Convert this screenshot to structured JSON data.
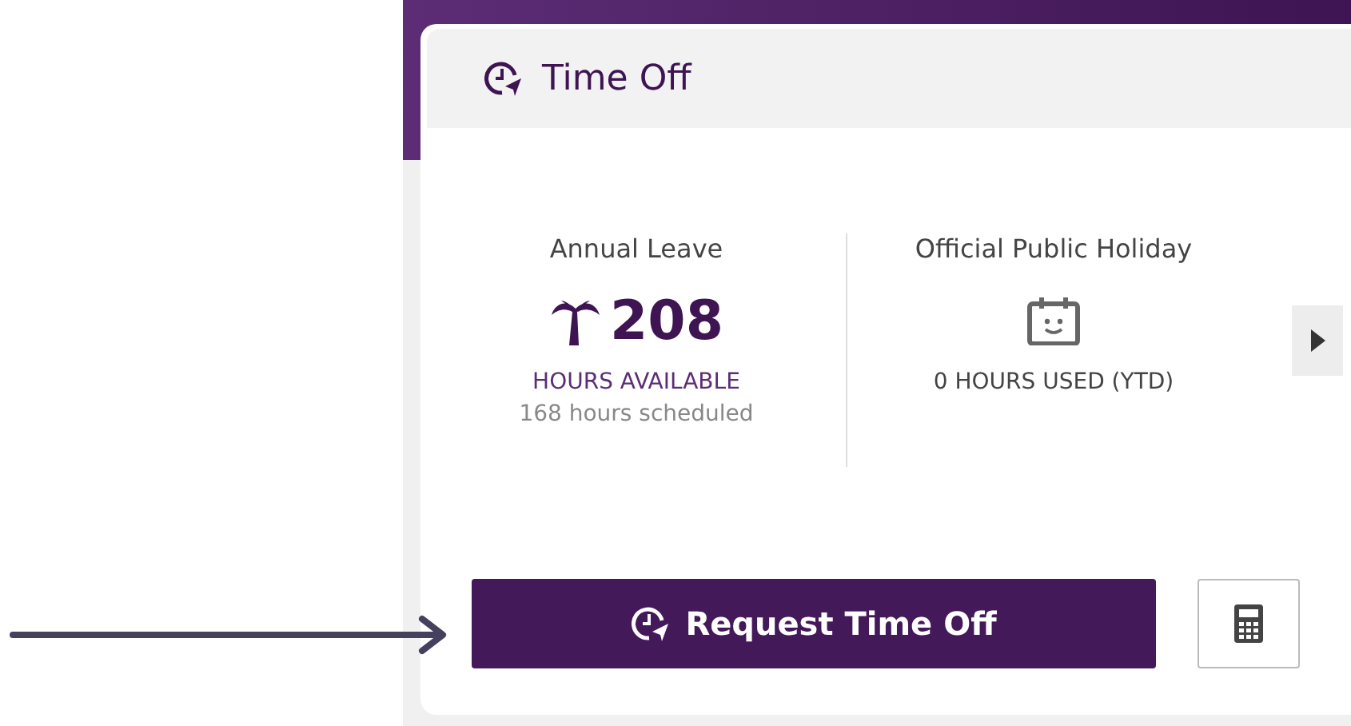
{
  "card": {
    "title": "Time Off"
  },
  "balances": [
    {
      "kind": "available",
      "title": "Annual Leave",
      "value": "208",
      "caption": "HOURS AVAILABLE",
      "note": "168 hours scheduled"
    },
    {
      "kind": "used",
      "title": "Official Public Holiday",
      "caption": "0 HOURS USED (YTD)"
    }
  ],
  "actions": {
    "primary": "Request Time Off"
  }
}
